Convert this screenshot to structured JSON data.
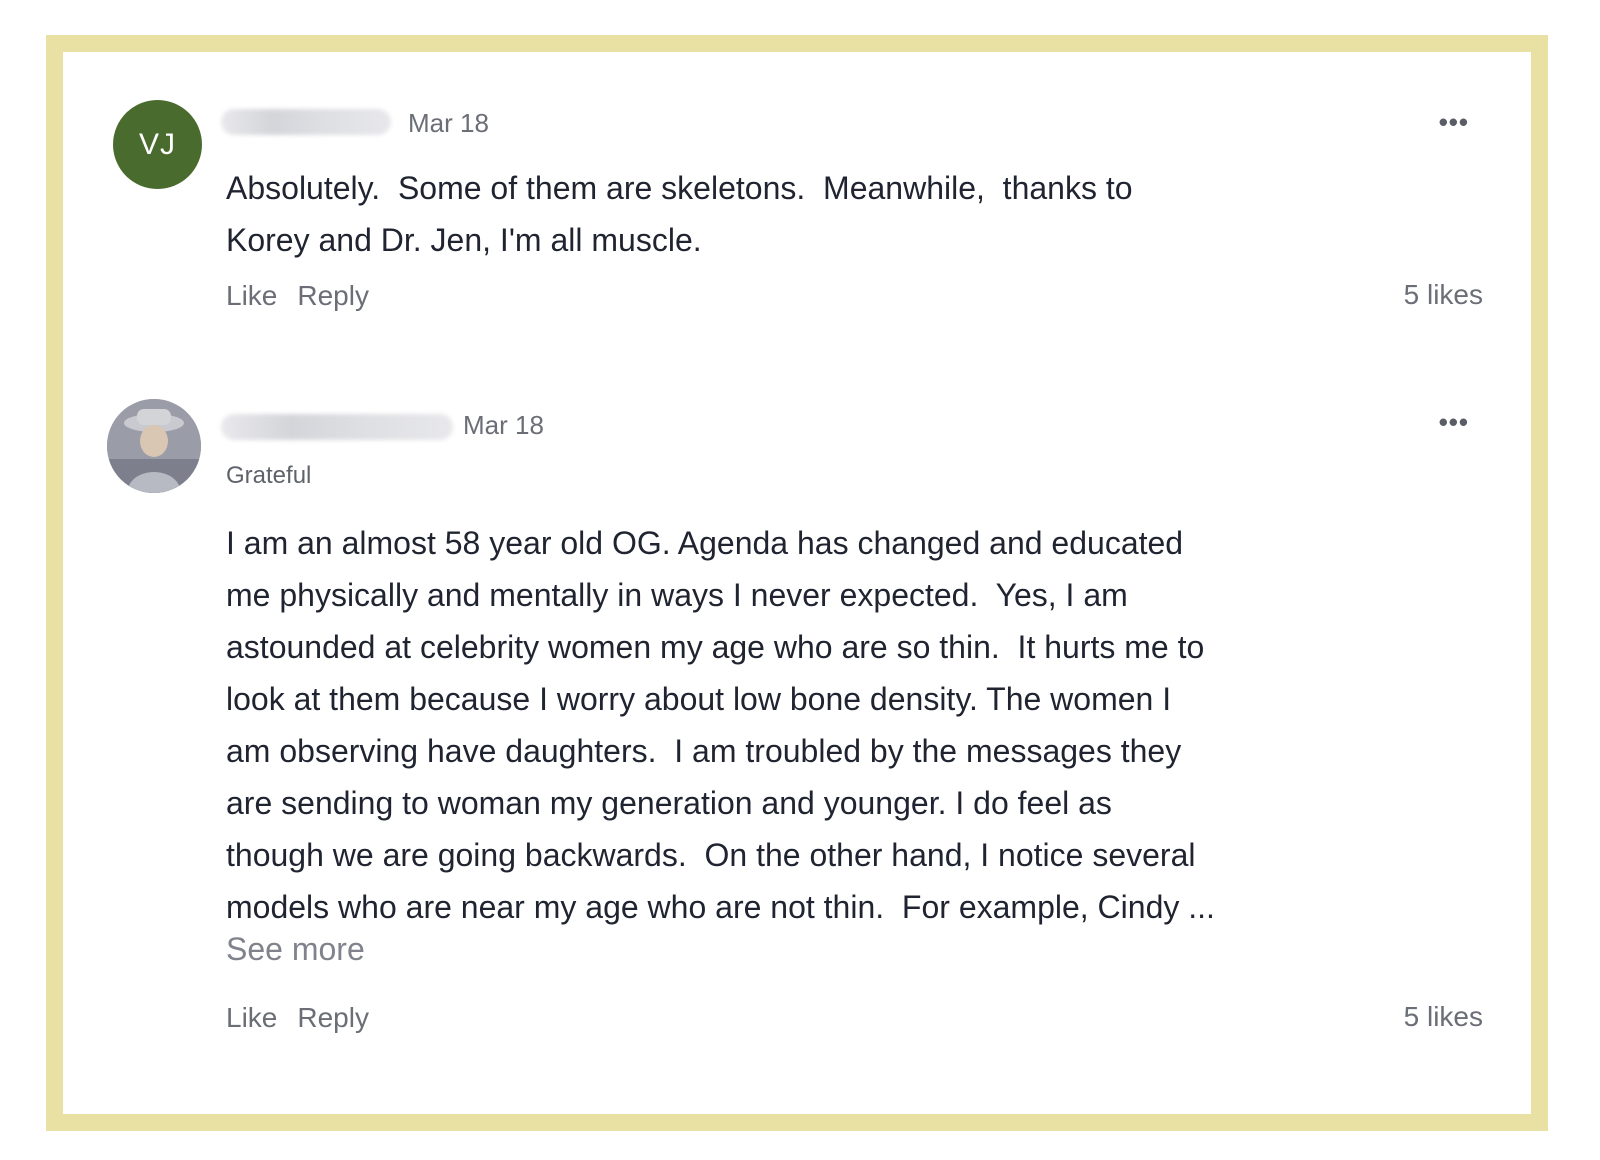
{
  "comments": [
    {
      "avatar_initials": "VJ",
      "avatar_color": "#4a6b2e",
      "date": "Mar 18",
      "more_icon": "•••",
      "body": "Absolutely.  Some of them are skeletons.  Meanwhile,  thanks to\nKorey and Dr. Jen, I'm all muscle.",
      "like_label": "Like",
      "reply_label": "Reply",
      "likes": "5 likes"
    },
    {
      "avatar_icon": "user-photo-avatar",
      "date": "Mar 18",
      "more_icon": "•••",
      "tag": "Grateful",
      "body": "I am an almost 58 year old OG. Agenda has changed and educated\nme physically and mentally in ways I never expected.  Yes, I am\nastounded at celebrity women my age who are so thin.  It hurts me to\nlook at them because I worry about low bone density. The women I\nam observing have daughters.  I am troubled by the messages they\nare sending to woman my generation and younger. I do feel as\nthough we are going backwards.  On the other hand, I notice several\nmodels who are near my age who are not thin.  For example, Cindy ...",
      "see_more": "See more",
      "like_label": "Like",
      "reply_label": "Reply",
      "likes": "5 likes"
    }
  ],
  "colors": {
    "frame_border": "#e9e1a3",
    "text": "#1f2430",
    "muted": "#6b6e76"
  }
}
